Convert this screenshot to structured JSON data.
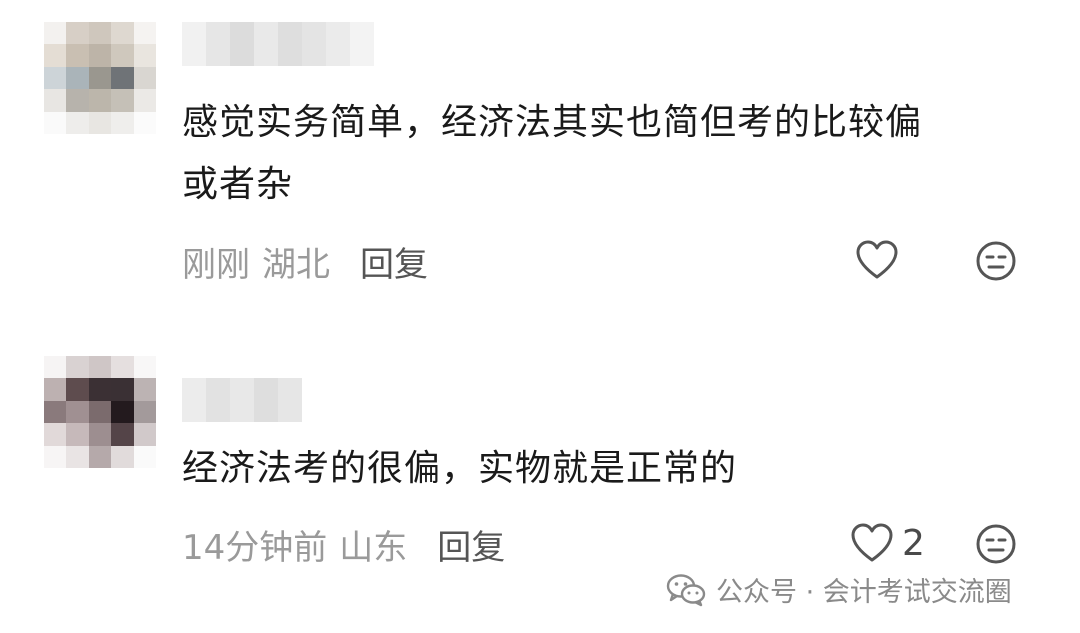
{
  "comments": [
    {
      "text_line1": "感觉实务简单，经济法其实也简但考的比较偏",
      "text_line2": "或者杂",
      "time": "刚刚",
      "region": "湖北",
      "reply_label": "回复",
      "like_count": ""
    },
    {
      "text_line1": "经济法考的很偏，实物就是正常的",
      "text_line2": "",
      "time": "14分钟前",
      "region": "山东",
      "reply_label": "回复",
      "like_count": "2"
    }
  ],
  "watermark": {
    "text": "公众号 · 会计考试交流圈",
    "icon": "wechat-icon"
  },
  "icons": {
    "like": "heart-outline-icon",
    "dislike": "neutral-face-icon"
  }
}
